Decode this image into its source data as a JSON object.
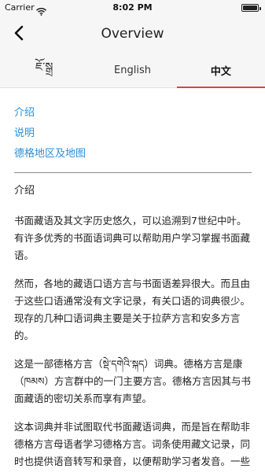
{
  "status_bar": {
    "carrier": "Carrier",
    "time": "8:02 PM"
  },
  "nav": {
    "title": "Overview"
  },
  "tabs": [
    {
      "label": "ཇོ་སྒྲ",
      "active": false
    },
    {
      "label": "English",
      "active": false
    },
    {
      "label": "中文",
      "active": true
    }
  ],
  "toc": [
    {
      "label": "介绍"
    },
    {
      "label": "说明"
    },
    {
      "label": "德格地区及地图"
    }
  ],
  "section": {
    "heading": "介绍",
    "paragraphs": [
      "书面藏语及其文字历史悠久，可以追溯到7世纪中叶。有许多优秀的书面语词典可以帮助用户学习掌握书面藏语。",
      "然而，各地的藏语口语方言与书面语差异很大。而且由于这些口语通常没有文字记录，有关口语的词典很少。现存的几种口语词典主要是关于拉萨方言和安多方言的。",
      "这是一部德格方言（སྡེ་དགེའི་སྐད）词典。德格方言是康（ཁམས）方言群中的一门主要方言。德格方言因其与书面藏语的密切关系而享有声望。",
      "这本词典并非试图取代书面藏语词典，而是旨在帮助非德格方言母语者学习德格方言。词条使用藏文记录，同时也提供语音转写和录音，以便帮助学习者发音。一些词汇使用了非标准"
    ]
  },
  "colors": {
    "link": "#2a8fd8",
    "tab_indicator": "#d64545",
    "bar_background": "#f6f6f6"
  }
}
